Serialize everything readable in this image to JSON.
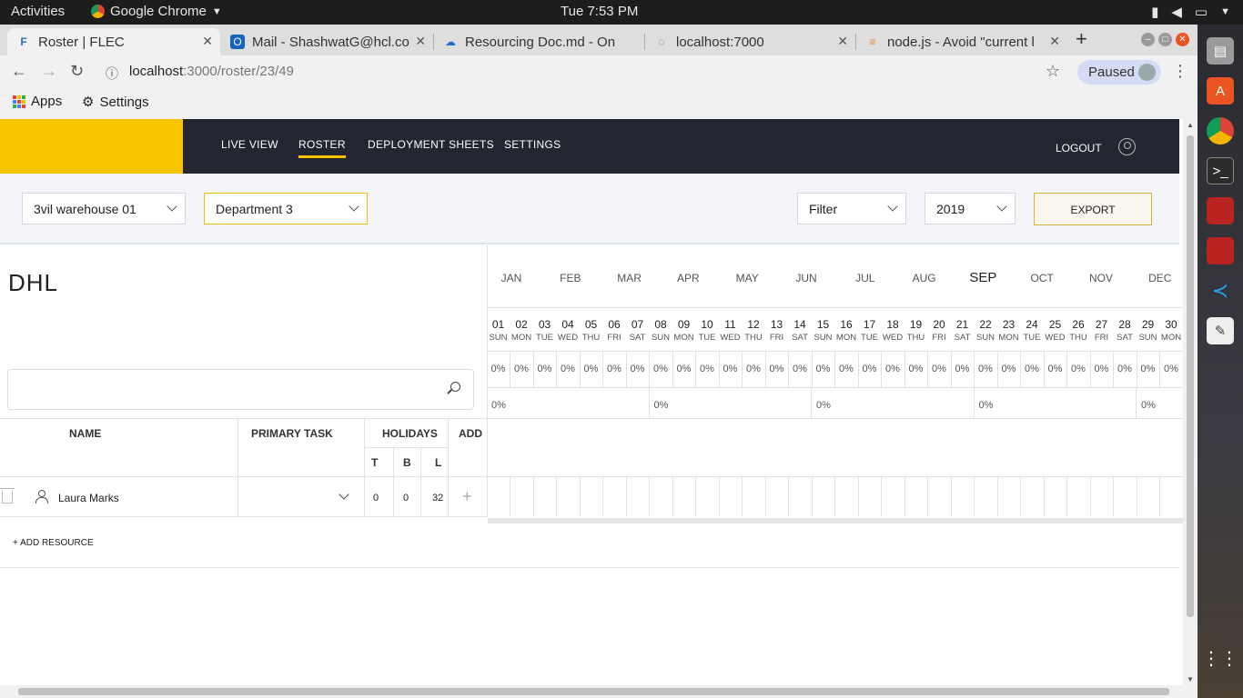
{
  "os": {
    "activities": "Activities",
    "app_name": "Google Chrome",
    "clock": "Tue  7:53 PM"
  },
  "browser": {
    "tabs": [
      {
        "title": "Roster | FLEC"
      },
      {
        "title": "Mail - ShashwatG@hcl.co"
      },
      {
        "title": "Resourcing Doc.md - On"
      },
      {
        "title": "localhost:7000"
      },
      {
        "title": "node.js - Avoid \"current l"
      }
    ],
    "url_host": "localhost",
    "url_path": ":3000/roster/23/49",
    "profile_status": "Paused",
    "bookmarks": [
      {
        "label": "Apps"
      },
      {
        "label": "Settings"
      }
    ]
  },
  "header": {
    "nav": [
      "LIVE VIEW",
      "ROSTER",
      "DEPLOYMENT SHEETS",
      "SETTINGS"
    ],
    "active_nav": "ROSTER",
    "logout": "LOGOUT",
    "accent": "#f8c400",
    "bg": "#232530"
  },
  "toolbar": {
    "warehouse": "3vil warehouse 01",
    "department": "Department 3",
    "filter": "Filter",
    "year": "2019",
    "export": "EXPORT"
  },
  "company": "DHL",
  "search": {
    "placeholder": ""
  },
  "months": [
    "JAN",
    "FEB",
    "MAR",
    "APR",
    "MAY",
    "JUN",
    "JUL",
    "AUG",
    "SEP",
    "OCT",
    "NOV",
    "DEC"
  ],
  "current_month": "SEP",
  "days": [
    {
      "n": "01",
      "w": "SUN"
    },
    {
      "n": "02",
      "w": "MON"
    },
    {
      "n": "03",
      "w": "TUE"
    },
    {
      "n": "04",
      "w": "WED"
    },
    {
      "n": "05",
      "w": "THU"
    },
    {
      "n": "06",
      "w": "FRI"
    },
    {
      "n": "07",
      "w": "SAT"
    },
    {
      "n": "08",
      "w": "SUN"
    },
    {
      "n": "09",
      "w": "MON"
    },
    {
      "n": "10",
      "w": "TUE"
    },
    {
      "n": "11",
      "w": "WED"
    },
    {
      "n": "12",
      "w": "THU"
    },
    {
      "n": "13",
      "w": "FRI"
    },
    {
      "n": "14",
      "w": "SAT"
    },
    {
      "n": "15",
      "w": "SUN"
    },
    {
      "n": "16",
      "w": "MON"
    },
    {
      "n": "17",
      "w": "TUE"
    },
    {
      "n": "18",
      "w": "WED"
    },
    {
      "n": "19",
      "w": "THU"
    },
    {
      "n": "20",
      "w": "FRI"
    },
    {
      "n": "21",
      "w": "SAT"
    },
    {
      "n": "22",
      "w": "SUN"
    },
    {
      "n": "23",
      "w": "MON"
    },
    {
      "n": "24",
      "w": "TUE"
    },
    {
      "n": "25",
      "w": "WED"
    },
    {
      "n": "26",
      "w": "THU"
    },
    {
      "n": "27",
      "w": "FRI"
    },
    {
      "n": "28",
      "w": "SAT"
    },
    {
      "n": "29",
      "w": "SUN"
    },
    {
      "n": "30",
      "w": "MON"
    }
  ],
  "daily_pct": "0%",
  "weekly_pct": [
    "0%",
    "0%",
    "0%",
    "0%",
    "0%"
  ],
  "columns": {
    "name": "NAME",
    "primary_task": "PRIMARY TASK",
    "holidays": "HOLIDAYS",
    "add": "ADD",
    "t": "T",
    "b": "B",
    "l": "L"
  },
  "resources": [
    {
      "name": "Laura Marks",
      "t": "0",
      "b": "0",
      "l": "32"
    }
  ],
  "add_resource": "+ ADD RESOURCE"
}
